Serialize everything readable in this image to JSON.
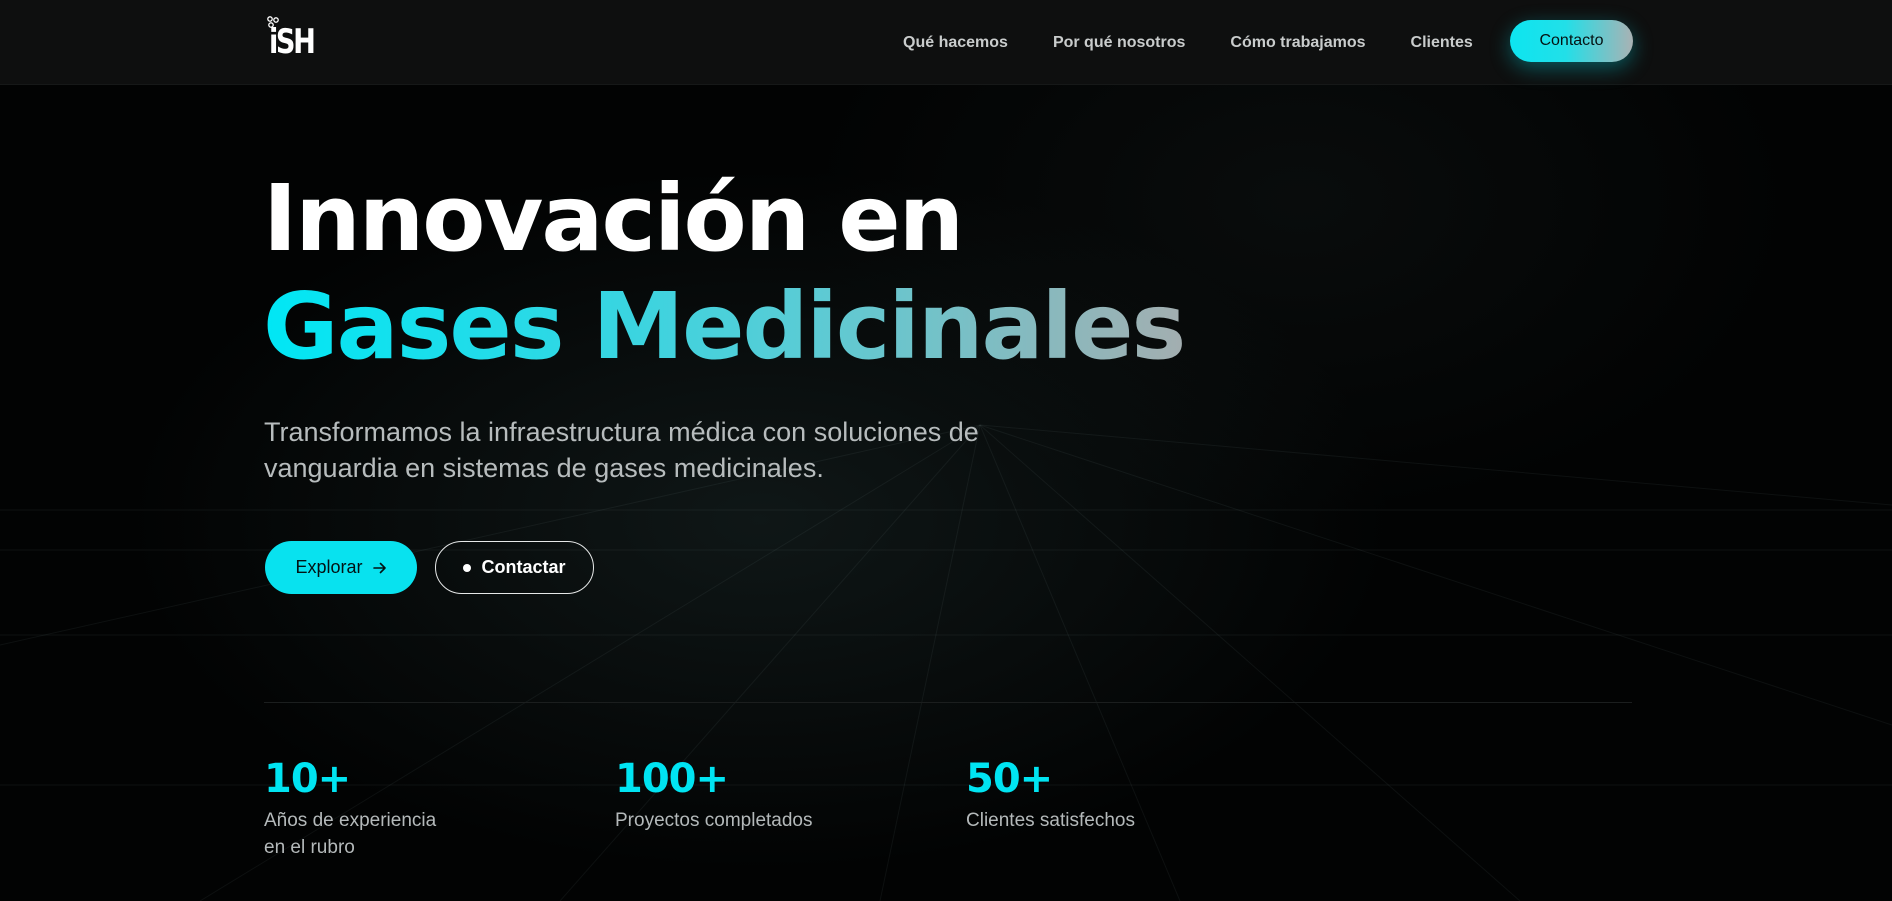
{
  "brand": {
    "logo_text": "iSH"
  },
  "nav": {
    "links": [
      {
        "label": "Qué hacemos"
      },
      {
        "label": "Por qué nosotros"
      },
      {
        "label": "Cómo trabajamos"
      },
      {
        "label": "Clientes"
      }
    ],
    "cta_label": "Contacto"
  },
  "hero": {
    "title_line1": "Innovación en",
    "title_line2": "Gases Medicinales",
    "subtitle": "Transformamos la infraestructura médica con soluciones de vanguardia en sistemas de gases medicinales.",
    "primary_button": "Explorar",
    "secondary_button": "Contactar"
  },
  "stats": [
    {
      "value": "10+",
      "label": "Años de experiencia en el rubro"
    },
    {
      "value": "100+",
      "label": "Proyectos completados"
    },
    {
      "value": "50+",
      "label": "Clientes satisfechos"
    }
  ],
  "colors": {
    "accent": "#00e4f2",
    "background": "#020303",
    "nav_background": "#0e0f0f"
  },
  "icons": {
    "explorar_button": "arrow-right-icon",
    "contactar_button": "dot-icon"
  }
}
